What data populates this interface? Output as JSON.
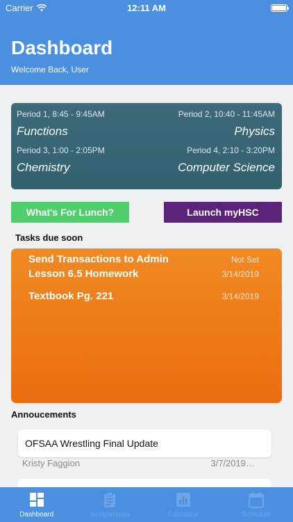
{
  "status_bar": {
    "carrier": "Carrier",
    "time": "12:11 AM"
  },
  "header": {
    "title": "Dashboard",
    "subtitle": "Welcome Back, User"
  },
  "schedule": [
    {
      "time": "Period 1, 8:45 - 9:45AM",
      "class": "Functions"
    },
    {
      "time": "Period 2, 10:40 - 11:45AM",
      "class": "Physics"
    },
    {
      "time": "Period 3, 1:00 - 2:05PM",
      "class": "Chemistry"
    },
    {
      "time": "Period 4, 2:10 - 3:20PM",
      "class": "Computer Science"
    }
  ],
  "buttons": {
    "lunch": "What's For Lunch?",
    "myhsc": "Launch myHSC"
  },
  "tasks": {
    "label": "Tasks due soon",
    "items": [
      {
        "title": "Send Transactions to Admin",
        "date": "Not Set"
      },
      {
        "title": "Lesson 6.5 Homework",
        "date": "3/14/2019"
      },
      {
        "title": "Textbook Pg. 221",
        "date": "3/14/2019"
      }
    ]
  },
  "announcements": {
    "label": "Annoucements",
    "items": [
      {
        "title": "OFSAA Wrestling Final Update",
        "author": "Kristy Faggion",
        "date": "3/7/2019…"
      }
    ]
  },
  "tabs": [
    {
      "label": "Dashboard",
      "icon": "dashboard-icon",
      "active": true
    },
    {
      "label": "Assignments",
      "icon": "clipboard-icon",
      "active": false
    },
    {
      "label": "Calculator",
      "icon": "chart-icon",
      "active": false
    },
    {
      "label": "Schedule",
      "icon": "calendar-icon",
      "active": false
    }
  ],
  "colors": {
    "header": "#4a8fe0",
    "schedule_card": "#3a6877",
    "lunch_button": "#4fcf6b",
    "myhsc_button": "#5c237a",
    "tasks_card": "#ee7a18"
  }
}
